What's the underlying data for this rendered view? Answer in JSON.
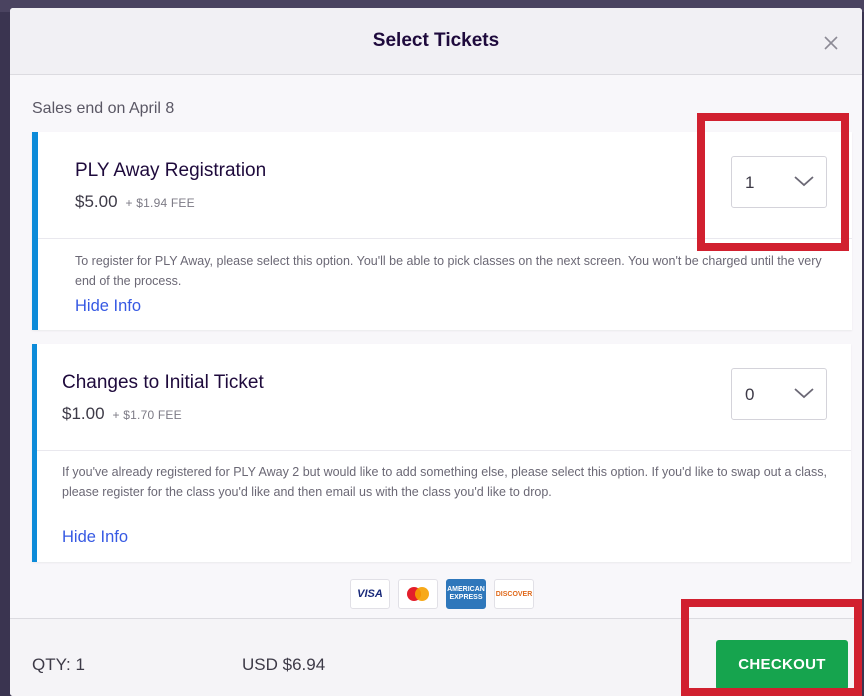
{
  "modal": {
    "title": "Select Tickets",
    "close_icon": "close-icon"
  },
  "sales_end": "Sales end on April 8",
  "tickets": [
    {
      "name": "PLY Away Registration",
      "price": "$5.00",
      "fee": "+ $1.94 FEE",
      "quantity": "1",
      "description": "To register for PLY Away, please select this option. You'll be able to pick classes on the next screen. You won't be charged until the very end of the process.",
      "hide_info": "Hide Info"
    },
    {
      "name": "Changes to Initial Ticket",
      "price": "$1.00",
      "fee": "+ $1.70 FEE",
      "quantity": "0",
      "description": "If you've already registered for PLY Away 2 but would like to add something else, please select this option. If you'd like to swap out a class, please register for the class you'd like and then email us with the class you'd like to drop.",
      "hide_info": "Hide Info"
    }
  ],
  "payments": {
    "visa": "VISA",
    "amex": "AMERICAN EXPRESS",
    "discover": "DISCOVER"
  },
  "footer": {
    "qty": "QTY: 1",
    "total": "USD $6.94",
    "checkout_label": "CHECKOUT"
  },
  "colors": {
    "accent_blue": "#0d8bd9",
    "checkout_green": "#16a44e",
    "link_blue": "#3659e3",
    "highlight_red": "#d1202f"
  }
}
